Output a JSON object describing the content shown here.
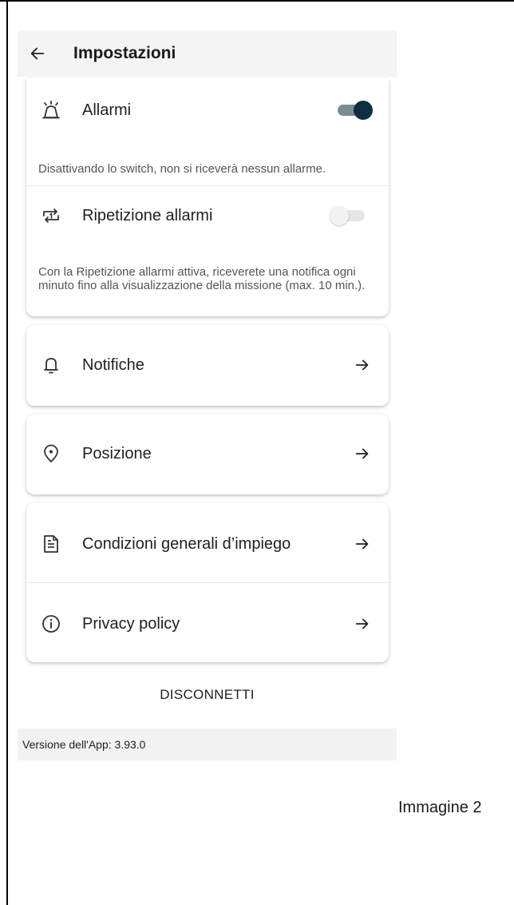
{
  "appbar": {
    "title": "Impostazioni",
    "back_icon": "arrow-left-icon"
  },
  "alarms_card": {
    "alarms": {
      "label": "Allarmi",
      "icon": "alarm-icon",
      "enabled": true,
      "description": "Disattivando lo switch, non si riceverà nessun allarme."
    },
    "repeat": {
      "label": "Ripetizione allarmi",
      "icon": "repeat-one-icon",
      "enabled": false,
      "description": "Con la Ripetizione allarmi attiva, riceverete una notifica ogni minuto fino alla visualizzazione della missione (max. 10 min.)."
    }
  },
  "menu": {
    "notifications": {
      "label": "Notifiche",
      "icon": "bell-icon"
    },
    "position": {
      "label": "Posizione",
      "icon": "location-pin-icon"
    },
    "terms": {
      "label": "Condizioni generali d’impiego",
      "icon": "document-icon"
    },
    "privacy": {
      "label": "Privacy policy",
      "icon": "info-icon"
    }
  },
  "logout_label": "DISCONNETTI",
  "version_text": "Versione dell'App: 3.93.0",
  "caption": "Immagine 2",
  "colors": {
    "toggle_on_knob": "#0f2e41",
    "toggle_on_track": "#7a8b93",
    "appbar_bg": "#f4f4f4"
  }
}
